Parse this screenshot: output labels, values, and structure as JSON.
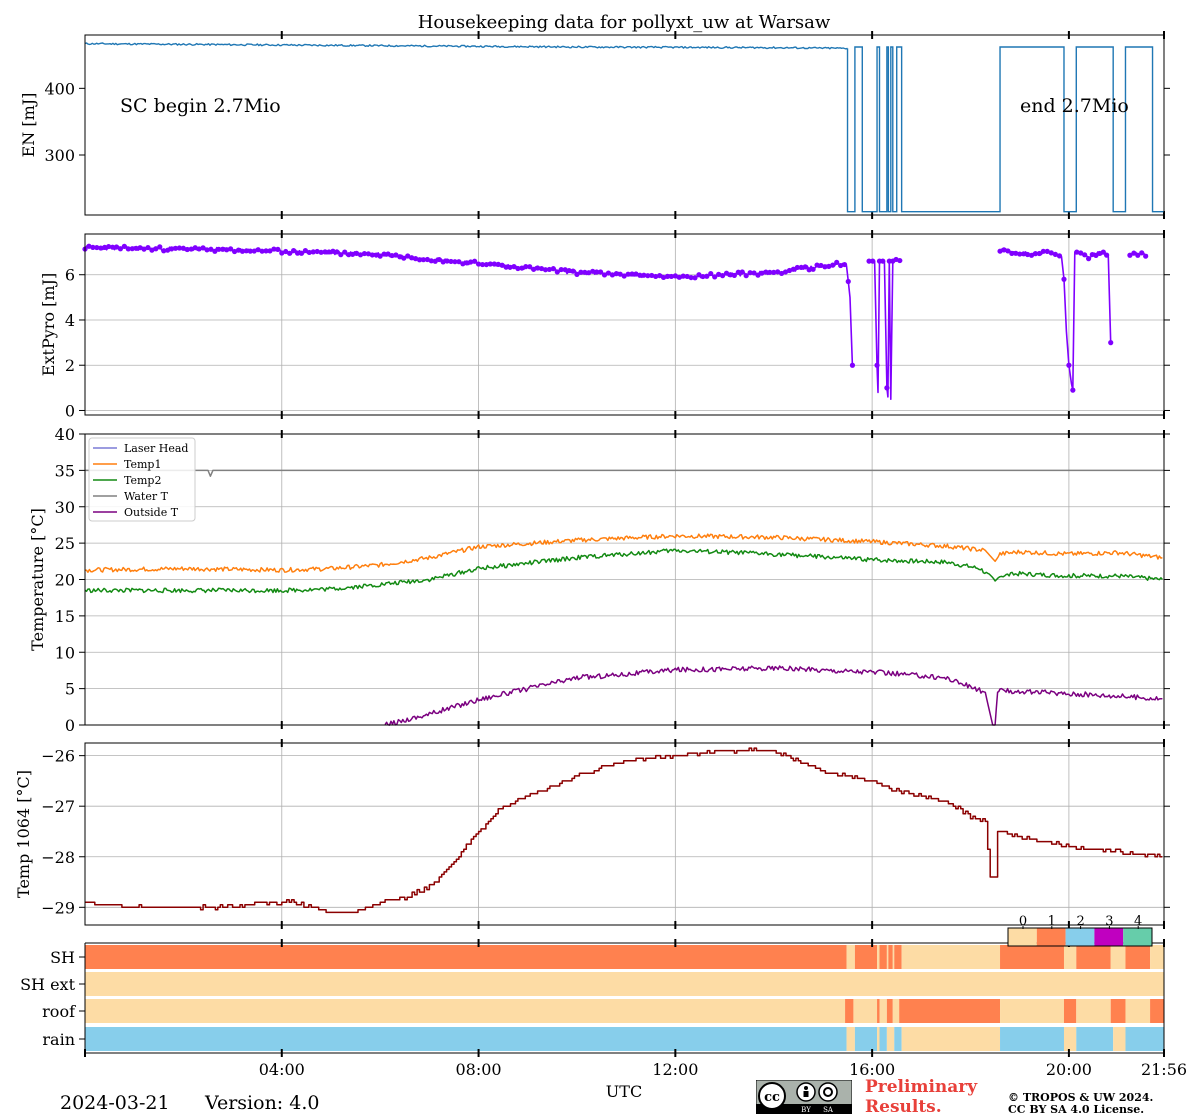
{
  "figure": {
    "title": "Housekeeping data for pollyxt_uw at Warsaw",
    "date": "2024-03-21",
    "version": "Version: 4.0",
    "preliminary": [
      "Preliminary",
      "Results."
    ],
    "copyright": [
      "© TROPOS & UW 2024.",
      "CC BY SA 4.0 License."
    ],
    "cc_badge": {
      "icon": "cc-by-sa-icon",
      "labels": [
        "BY",
        "SA"
      ]
    },
    "colors": {
      "en": "#1f77b4",
      "pyro": "#8000ff",
      "laser_head": "#7b7bd6",
      "temp1": "#ff7f0e",
      "temp2": "#138a13",
      "water": "#808080",
      "outside": "#7b0080",
      "temp1064": "#8b0000",
      "preliminary": "#e8403a"
    }
  },
  "chart_data": [
    {
      "type": "line",
      "ylabel": "EN [mJ]",
      "ylim": [
        210,
        480
      ],
      "yticks": [
        300,
        400
      ],
      "xlim": [
        0,
        21.933
      ],
      "grid": false,
      "annotations": [
        "SC begin 2.7Mio",
        "end 2.7Mio"
      ],
      "series": [
        {
          "x": [
            0,
            2,
            6,
            10,
            14,
            15.5
          ],
          "y": [
            467,
            466,
            464,
            462,
            461,
            460
          ],
          "gaps": [
            [
              15.5,
              15.65
            ],
            [
              15.8,
              16.1
            ],
            [
              16.15,
              16.3
            ],
            [
              16.33,
              16.38
            ],
            [
              16.42,
              16.5
            ],
            [
              16.6,
              18.6
            ],
            [
              19.9,
              20.15
            ],
            [
              20.9,
              21.15
            ],
            [
              21.7,
              21.93
            ]
          ],
          "low": 215
        }
      ]
    },
    {
      "type": "line",
      "ylabel": "ExtPyro [mJ]",
      "ylim": [
        -0.2,
        7.8
      ],
      "yticks": [
        0,
        2,
        4,
        6
      ],
      "xlim": [
        0,
        21.933
      ],
      "grid": true,
      "series": [
        {
          "x": [
            0,
            3,
            6,
            8,
            10,
            12,
            14,
            15.4,
            15.48,
            15.55,
            15.6,
            15.62,
            15.65,
            15.9,
            16.05,
            16.1,
            16.12,
            16.15,
            16.25,
            16.3,
            16.32,
            16.35,
            16.38,
            16.42,
            16.45,
            16.6
          ],
          "y": [
            7.2,
            7.1,
            6.9,
            6.5,
            6.1,
            5.9,
            6.1,
            6.5,
            6.4,
            5.0,
            2.0,
            0.1,
            null,
            6.6,
            6.6,
            2.0,
            0.8,
            6.6,
            6.6,
            1.0,
            0.6,
            6.6,
            0.5,
            6.6,
            6.7,
            6.6
          ]
        },
        {
          "x": [
            18.6,
            19.2,
            19.6,
            19.85,
            19.9,
            19.95,
            20.0,
            20.05,
            20.08,
            20.12,
            20.2,
            20.4,
            20.7,
            20.8,
            20.85,
            20.9,
            21.0,
            21.2,
            21.6,
            21.65,
            21.7
          ],
          "y": [
            7.1,
            6.9,
            7.0,
            6.8,
            5.8,
            3.5,
            2.0,
            1.2,
            0.9,
            7.0,
            7.0,
            6.8,
            7.0,
            6.8,
            3.0,
            0.5,
            null,
            6.9,
            6.9,
            0.5,
            null
          ]
        }
      ]
    },
    {
      "type": "line",
      "ylabel": "Temperature [$^\\circ C$]",
      "ylim": [
        0,
        40
      ],
      "yticks": [
        0,
        5,
        10,
        15,
        20,
        25,
        30,
        35,
        40
      ],
      "xlim": [
        0,
        21.933
      ],
      "grid": true,
      "legend": "top-left",
      "series": [
        {
          "name": "Laser Head",
          "x": [],
          "y": []
        },
        {
          "name": "Temp1",
          "x": [
            0,
            2,
            4,
            5,
            6,
            7,
            8,
            10,
            12,
            14,
            16,
            17.5,
            18.3,
            18.5,
            18.6,
            19,
            20,
            21,
            21.9
          ],
          "y": [
            21.3,
            21.5,
            21.3,
            21.5,
            22.0,
            23.0,
            24.5,
            25.4,
            26.0,
            25.8,
            25.2,
            24.6,
            24.0,
            22.5,
            23.5,
            23.8,
            23.5,
            23.7,
            23.0
          ]
        },
        {
          "name": "Temp2",
          "x": [
            0,
            2,
            4,
            5,
            6,
            7,
            8,
            10,
            12,
            14,
            16,
            17.5,
            18.2,
            18.5,
            18.6,
            19,
            20,
            21,
            21.9
          ],
          "y": [
            18.5,
            18.5,
            18.5,
            18.7,
            19.3,
            20.0,
            21.5,
            23.0,
            24.0,
            23.5,
            22.7,
            22.4,
            21.5,
            19.8,
            20.5,
            20.8,
            20.5,
            20.5,
            20.0
          ]
        },
        {
          "name": "Water T",
          "x": [
            0,
            2.5,
            2.55,
            2.6,
            21.93
          ],
          "y": [
            35,
            35,
            34.2,
            35,
            35
          ]
        },
        {
          "name": "Outside T",
          "x": [
            6.1,
            7,
            8,
            9,
            10,
            11,
            12,
            14,
            16,
            17.5,
            18.3,
            18.45,
            18.5,
            18.55,
            18.6,
            19,
            20,
            21,
            21.9
          ],
          "y": [
            0.0,
            1.5,
            3.5,
            5.0,
            6.5,
            7.0,
            7.6,
            7.8,
            7.3,
            6.5,
            4.5,
            0.0,
            0.0,
            4.5,
            4.7,
            4.6,
            4.3,
            4.0,
            3.6
          ]
        }
      ]
    },
    {
      "type": "line",
      "ylabel": "Temp 1064 [$^\\circ C$]",
      "ylim": [
        -29.35,
        -25.75
      ],
      "yticks": [
        -29,
        -28,
        -27,
        -26
      ],
      "xlim": [
        0,
        21.933
      ],
      "grid": true,
      "series": [
        {
          "x": [
            0,
            0.5,
            1,
            3,
            3.5,
            4.2,
            5,
            5.5,
            6,
            6.5,
            7,
            7.5,
            8,
            8.5,
            9,
            10,
            11,
            12,
            13,
            14,
            15,
            16,
            16.5,
            17,
            17.5,
            18,
            18.3,
            18.4,
            18.5,
            18.55,
            18.6,
            19,
            20,
            21,
            21.9
          ],
          "y": [
            -28.9,
            -28.95,
            -29.0,
            -29.0,
            -28.9,
            -28.9,
            -29.1,
            -29.1,
            -28.9,
            -28.8,
            -28.6,
            -28.1,
            -27.5,
            -27.0,
            -26.8,
            -26.4,
            -26.1,
            -26.0,
            -25.9,
            -25.9,
            -26.3,
            -26.5,
            -26.7,
            -26.8,
            -26.9,
            -27.2,
            -27.3,
            -28.4,
            -28.4,
            -27.5,
            -27.5,
            -27.6,
            -27.8,
            -27.9,
            -28.0
          ]
        }
      ]
    },
    {
      "type": "heatmap",
      "xlabel": "UTC",
      "xlim": [
        0,
        21.933
      ],
      "rows": [
        "SH",
        "SH ext",
        "roof",
        "rain"
      ],
      "colorbar": {
        "ticks": [
          "0",
          "1",
          "2",
          "3",
          "4"
        ],
        "colors": [
          "#fddca5",
          "#ff814f",
          "#87ceeb",
          "#c000c0",
          "#66cdaa"
        ]
      },
      "xtick_labels": [
        "04:00",
        "08:00",
        "12:00",
        "16:00",
        "20:00",
        "21:56"
      ],
      "xtick_values": [
        4,
        8,
        12,
        16,
        20,
        21.933
      ],
      "segments": {
        "SH": [
          [
            0,
            15.48,
            1
          ],
          [
            15.48,
            15.65,
            0
          ],
          [
            15.65,
            16.1,
            1
          ],
          [
            16.1,
            16.15,
            0
          ],
          [
            16.15,
            16.3,
            1
          ],
          [
            16.3,
            16.33,
            0
          ],
          [
            16.33,
            16.42,
            1
          ],
          [
            16.42,
            16.45,
            0
          ],
          [
            16.45,
            16.6,
            1
          ],
          [
            16.6,
            18.6,
            0
          ],
          [
            18.6,
            19.9,
            1
          ],
          [
            19.9,
            20.15,
            0
          ],
          [
            20.15,
            20.85,
            1
          ],
          [
            20.85,
            21.15,
            0
          ],
          [
            21.15,
            21.65,
            1
          ],
          [
            21.65,
            21.933,
            0
          ]
        ],
        "SH ext": [
          [
            0,
            21.933,
            0
          ]
        ],
        "roof": [
          [
            0,
            15.45,
            0
          ],
          [
            15.45,
            15.62,
            1
          ],
          [
            15.62,
            16.1,
            0
          ],
          [
            16.1,
            16.15,
            1
          ],
          [
            16.15,
            16.3,
            0
          ],
          [
            16.3,
            16.42,
            1
          ],
          [
            16.42,
            16.55,
            0
          ],
          [
            16.55,
            18.6,
            1
          ],
          [
            18.6,
            19.9,
            0
          ],
          [
            19.9,
            20.15,
            1
          ],
          [
            20.15,
            20.85,
            0
          ],
          [
            20.85,
            21.15,
            1
          ],
          [
            21.15,
            21.65,
            0
          ],
          [
            21.65,
            21.933,
            1
          ]
        ],
        "rain": [
          [
            0,
            15.48,
            2
          ],
          [
            15.48,
            15.65,
            0
          ],
          [
            15.65,
            16.1,
            2
          ],
          [
            16.1,
            16.15,
            0
          ],
          [
            16.15,
            16.3,
            2
          ],
          [
            16.3,
            16.45,
            0
          ],
          [
            16.45,
            16.6,
            2
          ],
          [
            16.6,
            18.6,
            0
          ],
          [
            18.6,
            19.9,
            2
          ],
          [
            19.9,
            20.15,
            0
          ],
          [
            20.15,
            20.9,
            2
          ],
          [
            20.9,
            21.15,
            0
          ],
          [
            21.15,
            21.933,
            2
          ]
        ]
      }
    }
  ]
}
